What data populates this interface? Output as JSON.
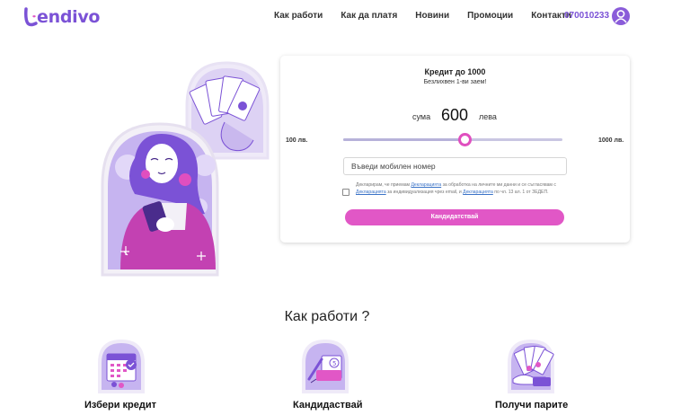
{
  "header": {
    "logo_text": "endivo",
    "nav": [
      {
        "label": "Как работи"
      },
      {
        "label": "Как да платя"
      },
      {
        "label": "Новини"
      },
      {
        "label": "Промоции"
      },
      {
        "label": "Контакти"
      }
    ],
    "phone": "070010233",
    "user_icon": "user-avatar-icon"
  },
  "loan_form": {
    "title": "Кредит до 1000",
    "subtitle": "Безлихвен 1-ви заем!",
    "amount_label": "сума",
    "amount_value": "600",
    "amount_unit": "лева",
    "min_label": "100 лв.",
    "max_label": "1000 лв.",
    "slider": {
      "min": 100,
      "max": 1000,
      "value": 600
    },
    "phone_placeholder": "Въведи мобилен номер",
    "consent": {
      "part1": "Декларирам, че приемам ",
      "link1": "Декларацията",
      "part2": " за обработка на личните ми данни и се съгласявам с ",
      "link2": "Декларацията",
      "part3": " за индивидуализация чрез email, и ",
      "link3": "Декларацията",
      "part4": " по чл. 13 ал. 1 от ЗЕДЕП."
    },
    "apply_label": "Кандидатствай"
  },
  "how_it_works": {
    "title": "Как работи ?",
    "steps": [
      {
        "label": "Избери кредит",
        "icon": "calendar-icon"
      },
      {
        "label": "Кандидаствай",
        "icon": "document-pen-icon"
      },
      {
        "label": "Получи парите",
        "icon": "cash-hand-icon"
      }
    ]
  },
  "colors": {
    "brand_purple": "#7b52d6",
    "accent_pink": "#e157c6",
    "lavender": "#c6b4f0"
  }
}
